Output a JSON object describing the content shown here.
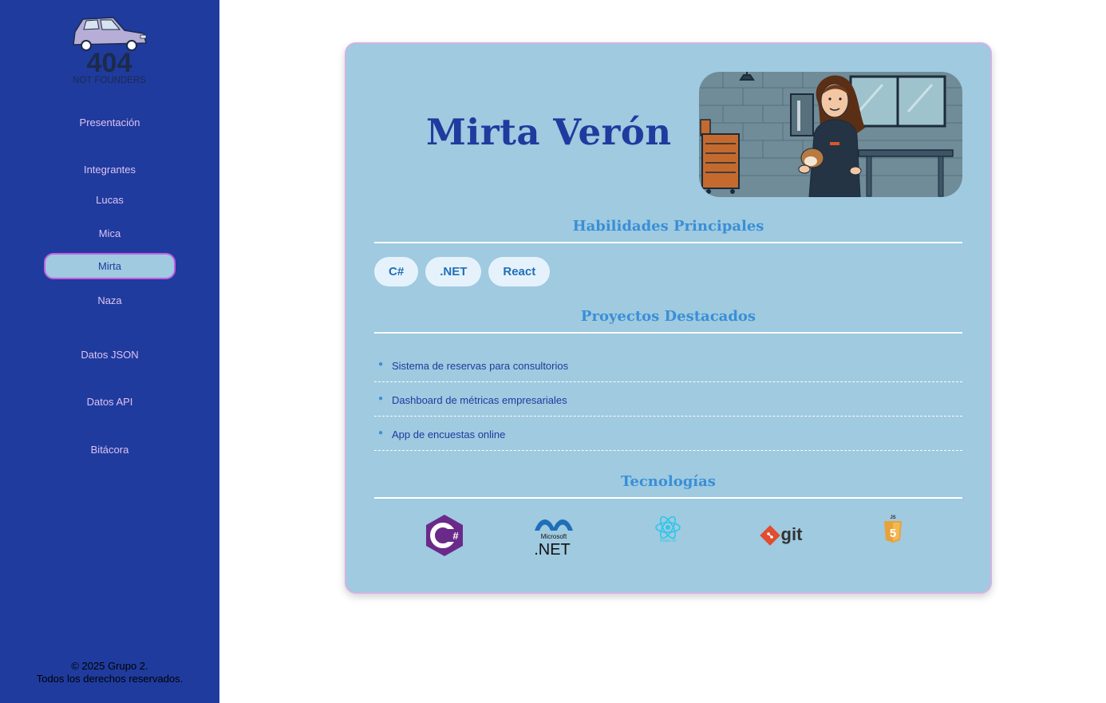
{
  "logo": {
    "title": "404",
    "subtitle": "NOT FOUNDERS"
  },
  "nav": {
    "presentacion": "Presentación",
    "integrantes": "Integrantes",
    "members": [
      "Lucas",
      "Mica",
      "Mirta",
      "Naza"
    ],
    "active_member": "Mirta",
    "datos_json": "Datos JSON",
    "datos_api": "Datos API",
    "bitacora": "Bitácora"
  },
  "footer": {
    "line1": "© 2025 Grupo 2.",
    "line2": "Todos los derechos reservados."
  },
  "profile": {
    "name": "Mirta Verón",
    "skills_title": "Habilidades Principales",
    "skills": [
      "C#",
      ".NET",
      "React"
    ],
    "projects_title": "Proyectos Destacados",
    "projects": [
      "Sistema de reservas para consultorios",
      "Dashboard de métricas empresariales",
      "App de encuestas online"
    ],
    "tech_title": "Tecnologías",
    "tech": [
      {
        "icon": "csharp-icon",
        "label": "C#"
      },
      {
        "icon": "dotnet-icon",
        "label": ".NET",
        "text": "Microsoft"
      },
      {
        "icon": "react-icon",
        "label": "React JS"
      },
      {
        "icon": "git-icon",
        "label": "git"
      },
      {
        "icon": "html5-icon",
        "label": "5"
      }
    ]
  },
  "colors": {
    "sidebar": "#1f3b9e",
    "card": "#9fcae0",
    "accent": "#3a8fd6",
    "active_border": "#c45ee0",
    "nav_text": "#dfc3f2"
  }
}
